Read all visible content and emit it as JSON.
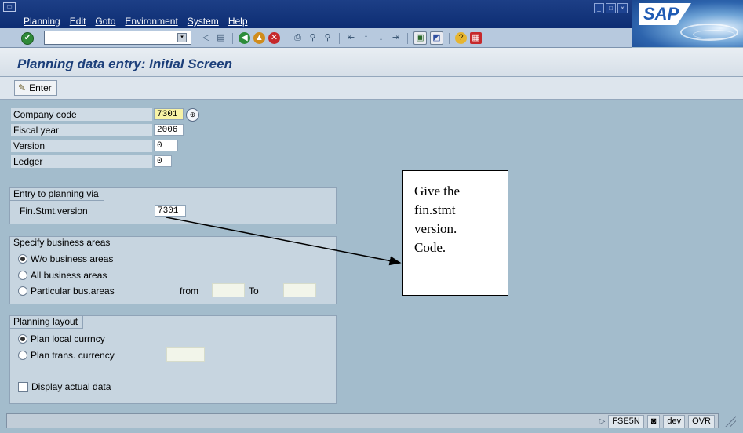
{
  "window": {
    "logo_text": "SAP",
    "menus": [
      "Planning",
      "Edit",
      "Goto",
      "Environment",
      "System",
      "Help"
    ]
  },
  "toolbar": {
    "command_value": ""
  },
  "page_title": "Planning data entry: Initial Screen",
  "app_toolbar": {
    "enter_label": "Enter"
  },
  "fields": [
    {
      "label": "Company code",
      "value": "7301"
    },
    {
      "label": "Fiscal year",
      "value": "2006"
    },
    {
      "label": "Version",
      "value": "0"
    },
    {
      "label": "Ledger",
      "value": "0"
    }
  ],
  "entry_group": {
    "title": "Entry to planning via",
    "field_label": "Fin.Stmt.version",
    "field_value": "7301"
  },
  "business_group": {
    "title": "Specify business areas",
    "options": [
      "W/o business areas",
      "All business areas",
      "Particular bus.areas"
    ],
    "selected": "W/o business areas",
    "from_label": "from",
    "to_label": "To"
  },
  "layout_group": {
    "title": "Planning layout",
    "options": [
      "Plan local currncy",
      "Plan trans. currency"
    ],
    "selected": "Plan local currncy",
    "checkbox_label": "Display actual data"
  },
  "callout": {
    "lines": [
      "Give the",
      "fin.stmt",
      "version.",
      "Code."
    ]
  },
  "status": {
    "transaction": "FSE5N",
    "system": "dev",
    "mode": "OVR"
  },
  "colors": {
    "background": "#a3bccc",
    "title": "#1c3f7a",
    "required_field": "#f8f3a6"
  }
}
